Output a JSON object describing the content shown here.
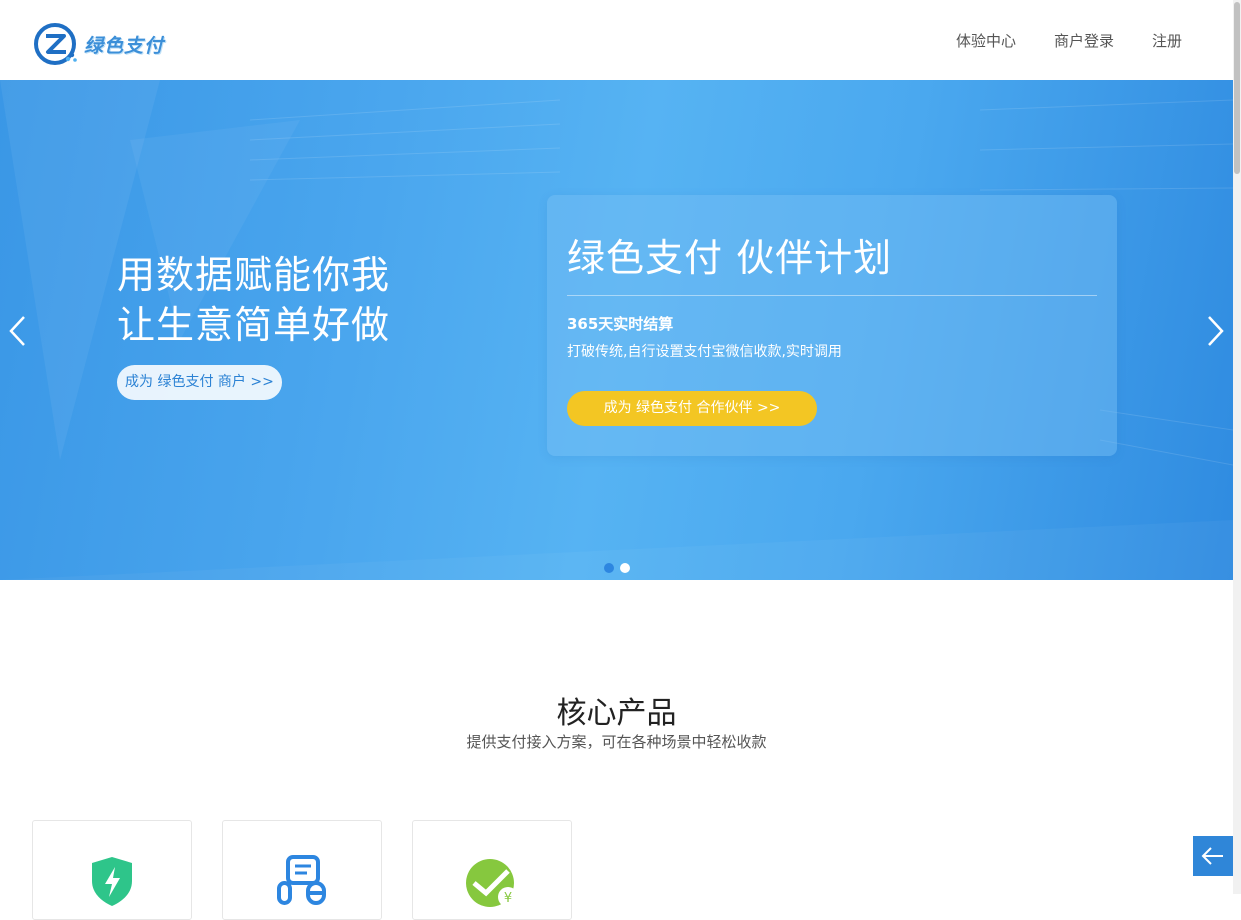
{
  "header": {
    "logo_text": "绿色支付",
    "nav": [
      "体验中心",
      "商户登录",
      "注册"
    ]
  },
  "banner": {
    "headline_line1": "用数据赋能你我",
    "headline_line2": "让生意简单好做",
    "merchant_button": "成为 绿色支付 商户 >>",
    "partner": {
      "title": "绿色支付 伙伴计划",
      "subtitle": "365天实时结算",
      "description": "打破传统,自行设置支付宝微信收款,实时调用",
      "button": "成为 绿色支付 合作伙伴 >>"
    },
    "active_slide": 1,
    "slide_count": 2
  },
  "products": {
    "title": "核心产品",
    "subtitle": "提供支付接入方案，可在各种场景中轻松收款",
    "cards": [
      {
        "icon": "green-shield-lightning-icon"
      },
      {
        "icon": "blue-document-link-icon"
      },
      {
        "icon": "green-yen-check-icon"
      }
    ]
  },
  "colors": {
    "brand_blue": "#2d86e0",
    "accent_yellow": "#f3c623",
    "green": "#2ec58a"
  }
}
